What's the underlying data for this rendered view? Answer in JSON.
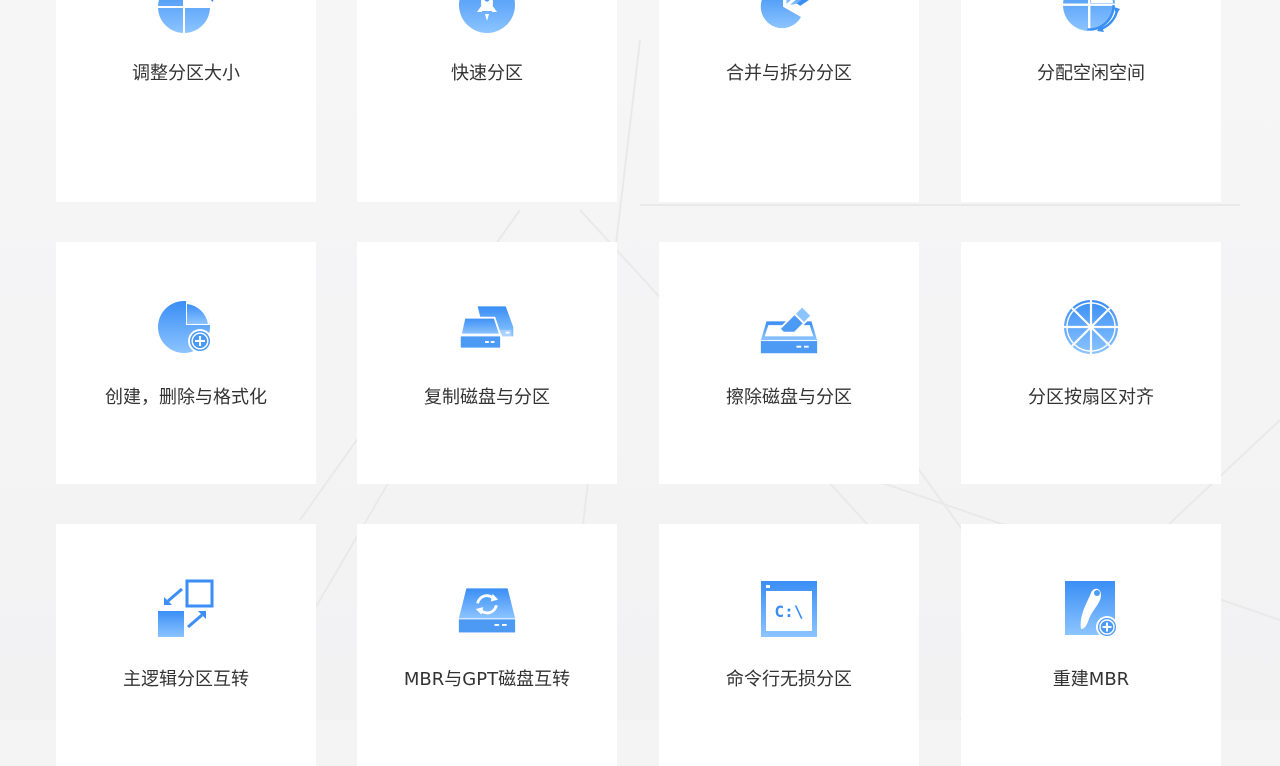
{
  "features": [
    {
      "label": "调整分区大小",
      "icon": "resize-partition-icon"
    },
    {
      "label": "快速分区",
      "icon": "rocket-icon"
    },
    {
      "label": "合并与拆分分区",
      "icon": "merge-split-icon"
    },
    {
      "label": "分配空闲空间",
      "icon": "allocate-space-icon"
    },
    {
      "label": "创建，删除与格式化",
      "icon": "create-partition-icon"
    },
    {
      "label": "复制磁盘与分区",
      "icon": "copy-disk-icon"
    },
    {
      "label": "擦除磁盘与分区",
      "icon": "wipe-disk-icon"
    },
    {
      "label": "分区按扇区对齐",
      "icon": "sector-align-icon"
    },
    {
      "label": "主逻辑分区互转",
      "icon": "convert-primary-logical-icon"
    },
    {
      "label": "MBR与GPT磁盘互转",
      "icon": "mbr-gpt-convert-icon"
    },
    {
      "label": "命令行无损分区",
      "icon": "command-line-icon"
    },
    {
      "label": "重建MBR",
      "icon": "rebuild-mbr-icon"
    }
  ],
  "colors": {
    "accent_light": "#7cbcff",
    "accent_dark": "#2f86f0",
    "card_bg": "#ffffff",
    "page_bg": "#f4f4f5",
    "text": "#333333"
  }
}
